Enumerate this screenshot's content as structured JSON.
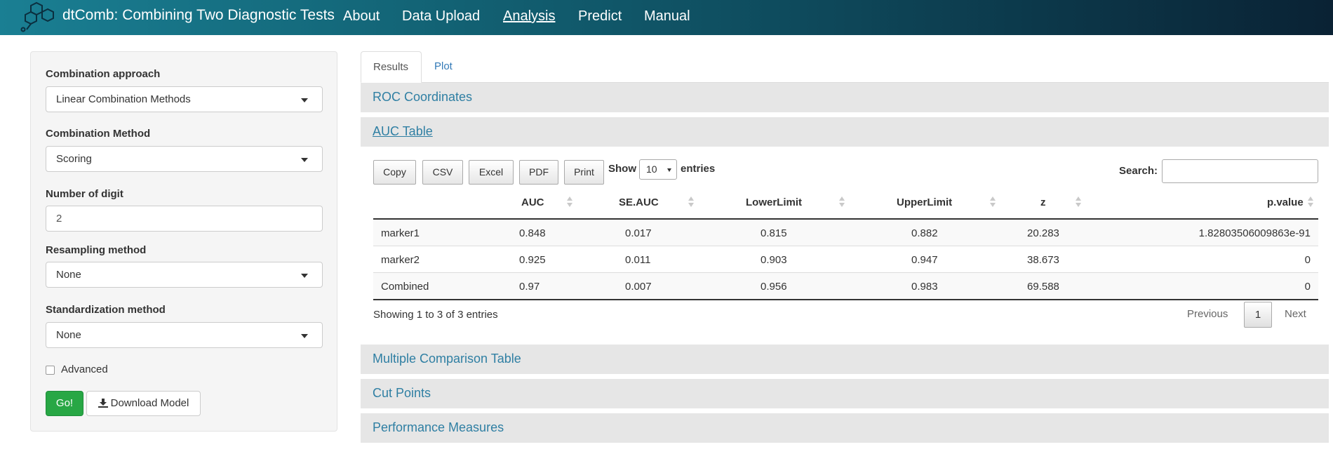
{
  "navbar": {
    "brand": "dtComb: Combining Two Diagnostic Tests",
    "items": [
      "About",
      "Data Upload",
      "Analysis",
      "Predict",
      "Manual"
    ],
    "active": "Analysis"
  },
  "sidebar": {
    "combination_approach": {
      "label": "Combination approach",
      "value": "Linear Combination Methods"
    },
    "combination_method": {
      "label": "Combination Method",
      "value": "Scoring"
    },
    "digits": {
      "label": "Number of digit",
      "value": "2"
    },
    "resampling": {
      "label": "Resampling method",
      "value": "None"
    },
    "standardization": {
      "label": "Standardization method",
      "value": "None"
    },
    "advanced": {
      "label": "Advanced",
      "checked": false
    },
    "go_label": "Go!",
    "download_label": "Download Model"
  },
  "tabs": [
    "Results",
    "Plot"
  ],
  "panels": {
    "roc": "ROC Coordinates",
    "auc": "AUC Table",
    "multiple": "Multiple Comparison Table",
    "cut": "Cut Points",
    "performance": "Performance Measures"
  },
  "table_controls": {
    "buttons": [
      "Copy",
      "CSV",
      "Excel",
      "PDF",
      "Print"
    ],
    "show": "Show",
    "length": "10",
    "entries": "entries",
    "search": "Search:"
  },
  "table": {
    "columns": [
      "AUC",
      "SE.AUC",
      "LowerLimit",
      "UpperLimit",
      "z",
      "p.value"
    ],
    "rows": [
      [
        "marker1",
        "0.848",
        "0.017",
        "0.815",
        "0.882",
        "20.283",
        "1.82803506009863e-91"
      ],
      [
        "marker2",
        "0.925",
        "0.011",
        "0.903",
        "0.947",
        "38.673",
        "0"
      ],
      [
        "Combined",
        "0.97",
        "0.007",
        "0.956",
        "0.983",
        "69.588",
        "0"
      ]
    ]
  },
  "footer": {
    "info": "Showing 1 to 3 of 3 entries",
    "previous": "Previous",
    "page": "1",
    "next": "Next"
  }
}
